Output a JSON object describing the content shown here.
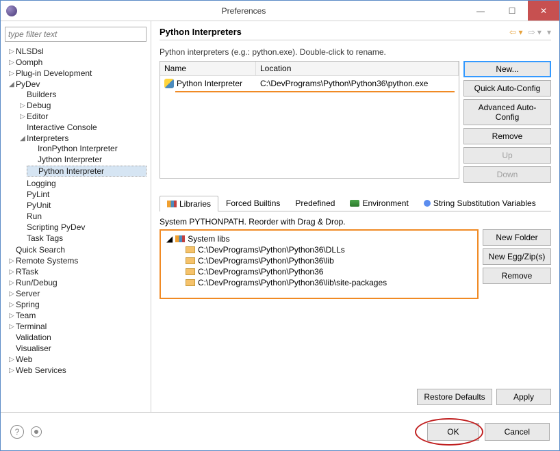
{
  "window": {
    "title": "Preferences"
  },
  "filter": {
    "placeholder": "type filter text"
  },
  "tree": {
    "nlsdsl": "NLSDsl",
    "oomph": "Oomph",
    "plugin_dev": "Plug-in Development",
    "pydev": "PyDev",
    "builders": "Builders",
    "debug": "Debug",
    "editor": "Editor",
    "interactive_console": "Interactive Console",
    "interpreters": "Interpreters",
    "ironpython": "IronPython Interpreter",
    "jython": "Jython Interpreter",
    "python": "Python Interpreter",
    "logging": "Logging",
    "pylint": "PyLint",
    "pyunit": "PyUnit",
    "run": "Run",
    "scripting": "Scripting PyDev",
    "tasktags": "Task Tags",
    "quicksearch": "Quick Search",
    "remote": "Remote Systems",
    "rtask": "RTask",
    "rundebug": "Run/Debug",
    "server": "Server",
    "spring": "Spring",
    "team": "Team",
    "terminal": "Terminal",
    "validation": "Validation",
    "visualiser": "Visualiser",
    "web": "Web",
    "webservices": "Web Services"
  },
  "main": {
    "title": "Python Interpreters",
    "desc": "Python interpreters (e.g.: python.exe).   Double-click to rename.",
    "cols": {
      "name": "Name",
      "location": "Location"
    },
    "row": {
      "name": "Python Interpreter",
      "location": "C:\\DevPrograms\\Python\\Python36\\python.exe"
    },
    "buttons": {
      "new": "New...",
      "quick": "Quick Auto-Config",
      "adv": "Advanced Auto-Config",
      "remove": "Remove",
      "up": "Up",
      "down": "Down"
    },
    "tabs": {
      "libraries": "Libraries",
      "forced": "Forced Builtins",
      "predefined": "Predefined",
      "env": "Environment",
      "ssv": "String Substitution Variables"
    },
    "pp_label": "System PYTHONPATH.   Reorder with Drag & Drop.",
    "syslibs": "System libs",
    "paths": [
      "C:\\DevPrograms\\Python\\Python36\\DLLs",
      "C:\\DevPrograms\\Python\\Python36\\lib",
      "C:\\DevPrograms\\Python\\Python36",
      "C:\\DevPrograms\\Python\\Python36\\lib\\site-packages"
    ],
    "lib_buttons": {
      "newfolder": "New Folder",
      "newegg": "New Egg/Zip(s)",
      "remove": "Remove"
    },
    "restore": "Restore Defaults",
    "apply": "Apply"
  },
  "footer": {
    "ok": "OK",
    "cancel": "Cancel"
  }
}
